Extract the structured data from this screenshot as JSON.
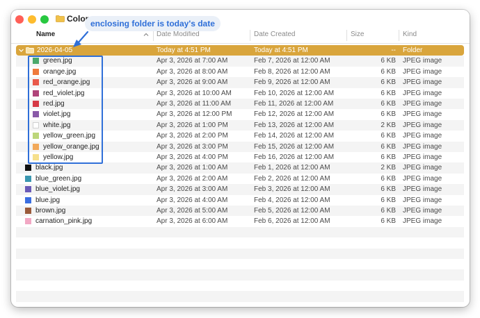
{
  "window": {
    "title": "Colors"
  },
  "columns": {
    "name": "Name",
    "date_modified": "Date Modified",
    "date_created": "Date Created",
    "size": "Size",
    "kind": "Kind"
  },
  "annotation": {
    "text": "enclosing folder is today's date"
  },
  "folder": {
    "name": "2026-04-05",
    "date_modified": "Today at 4:51 PM",
    "date_created": "Today at 4:51 PM",
    "size": "--",
    "kind": "Folder",
    "color": "#d9a53c"
  },
  "files": [
    {
      "name": "green.jpg",
      "date_modified": "Apr 3, 2026 at 7:00 AM",
      "date_created": "Feb 7, 2026 at 12:00 AM",
      "size": "6 KB",
      "kind": "JPEG image",
      "color": "#4aa86a",
      "in_folder": true
    },
    {
      "name": "orange.jpg",
      "date_modified": "Apr 3, 2026 at 8:00 AM",
      "date_created": "Feb 8, 2026 at 12:00 AM",
      "size": "6 KB",
      "kind": "JPEG image",
      "color": "#ef7a3c",
      "in_folder": true
    },
    {
      "name": "red_orange.jpg",
      "date_modified": "Apr 3, 2026 at 9:00 AM",
      "date_created": "Feb 9, 2026 at 12:00 AM",
      "size": "6 KB",
      "kind": "JPEG image",
      "color": "#e9594a",
      "in_folder": true
    },
    {
      "name": "red_violet.jpg",
      "date_modified": "Apr 3, 2026 at 10:00 AM",
      "date_created": "Feb 10, 2026 at 12:00 AM",
      "size": "6 KB",
      "kind": "JPEG image",
      "color": "#b0447a",
      "in_folder": true
    },
    {
      "name": "red.jpg",
      "date_modified": "Apr 3, 2026 at 11:00 AM",
      "date_created": "Feb 11, 2026 at 12:00 AM",
      "size": "6 KB",
      "kind": "JPEG image",
      "color": "#d63a45",
      "in_folder": true
    },
    {
      "name": "violet.jpg",
      "date_modified": "Apr 3, 2026 at 12:00 PM",
      "date_created": "Feb 12, 2026 at 12:00 AM",
      "size": "6 KB",
      "kind": "JPEG image",
      "color": "#8a5aa8",
      "in_folder": true
    },
    {
      "name": "white.jpg",
      "date_modified": "Apr 3, 2026 at 1:00 PM",
      "date_created": "Feb 13, 2026 at 12:00 AM",
      "size": "2 KB",
      "kind": "JPEG image",
      "color": "#ffffff",
      "in_folder": true
    },
    {
      "name": "yellow_green.jpg",
      "date_modified": "Apr 3, 2026 at 2:00 PM",
      "date_created": "Feb 14, 2026 at 12:00 AM",
      "size": "6 KB",
      "kind": "JPEG image",
      "color": "#bcd67a",
      "in_folder": true
    },
    {
      "name": "yellow_orange.jpg",
      "date_modified": "Apr 3, 2026 at 3:00 PM",
      "date_created": "Feb 15, 2026 at 12:00 AM",
      "size": "6 KB",
      "kind": "JPEG image",
      "color": "#f2a95a",
      "in_folder": true
    },
    {
      "name": "yellow.jpg",
      "date_modified": "Apr 3, 2026 at 4:00 PM",
      "date_created": "Feb 16, 2026 at 12:00 AM",
      "size": "6 KB",
      "kind": "JPEG image",
      "color": "#f6e08c",
      "in_folder": true
    },
    {
      "name": "black.jpg",
      "date_modified": "Apr 3, 2026 at 1:00 AM",
      "date_created": "Feb 1, 2026 at 12:00 AM",
      "size": "2 KB",
      "kind": "JPEG image",
      "color": "#111111",
      "in_folder": false
    },
    {
      "name": "blue_green.jpg",
      "date_modified": "Apr 3, 2026 at 2:00 AM",
      "date_created": "Feb 2, 2026 at 12:00 AM",
      "size": "6 KB",
      "kind": "JPEG image",
      "color": "#3a97b0",
      "in_folder": false
    },
    {
      "name": "blue_violet.jpg",
      "date_modified": "Apr 3, 2026 at 3:00 AM",
      "date_created": "Feb 3, 2026 at 12:00 AM",
      "size": "6 KB",
      "kind": "JPEG image",
      "color": "#6a5ab8",
      "in_folder": false
    },
    {
      "name": "blue.jpg",
      "date_modified": "Apr 3, 2026 at 4:00 AM",
      "date_created": "Feb 4, 2026 at 12:00 AM",
      "size": "6 KB",
      "kind": "JPEG image",
      "color": "#3a6ee0",
      "in_folder": false
    },
    {
      "name": "brown.jpg",
      "date_modified": "Apr 3, 2026 at 5:00 AM",
      "date_created": "Feb 5, 2026 at 12:00 AM",
      "size": "6 KB",
      "kind": "JPEG image",
      "color": "#9a5a3a",
      "in_folder": false
    },
    {
      "name": "carnation_pink.jpg",
      "date_modified": "Apr 3, 2026 at 6:00 AM",
      "date_created": "Feb 6, 2026 at 12:00 AM",
      "size": "6 KB",
      "kind": "JPEG image",
      "color": "#f2a8c4",
      "in_folder": false
    }
  ],
  "colors": {
    "accent": "#2f6fd8",
    "selection": "#d9a53c"
  },
  "icons": [
    "folder-icon",
    "chevron-up-icon",
    "disclosure-chevron-icon",
    "arrow-icon"
  ]
}
